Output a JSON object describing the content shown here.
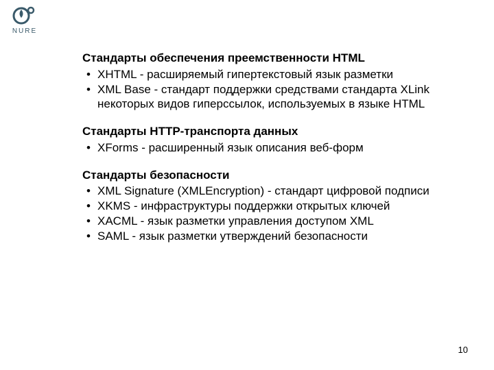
{
  "logo_text": "NURE",
  "page_number": "10",
  "sections": [
    {
      "heading": "Стандарты обеспечения преемственности HTML",
      "items": [
        "XHTML - расширяемый гипертекстовый язык разметки",
        "XML Base - стандарт поддержки средствами стандарта XLink некоторых видов гиперссылок, используемых в языке HTML"
      ]
    },
    {
      "heading": "Стандарты HTTP-транспорта данных",
      "items": [
        "XForms - расширенный язык описания веб-форм"
      ]
    },
    {
      "heading": "Стандарты безопасности",
      "items": [
        "XML Signature (XMLEncryption) - стандарт цифровой подписи",
        "XKMS - инфраструктуры поддержки открытых ключей",
        "XACML - язык разметки управления доступом XML",
        "SAML - язык разметки утверждений безопасности"
      ]
    }
  ]
}
